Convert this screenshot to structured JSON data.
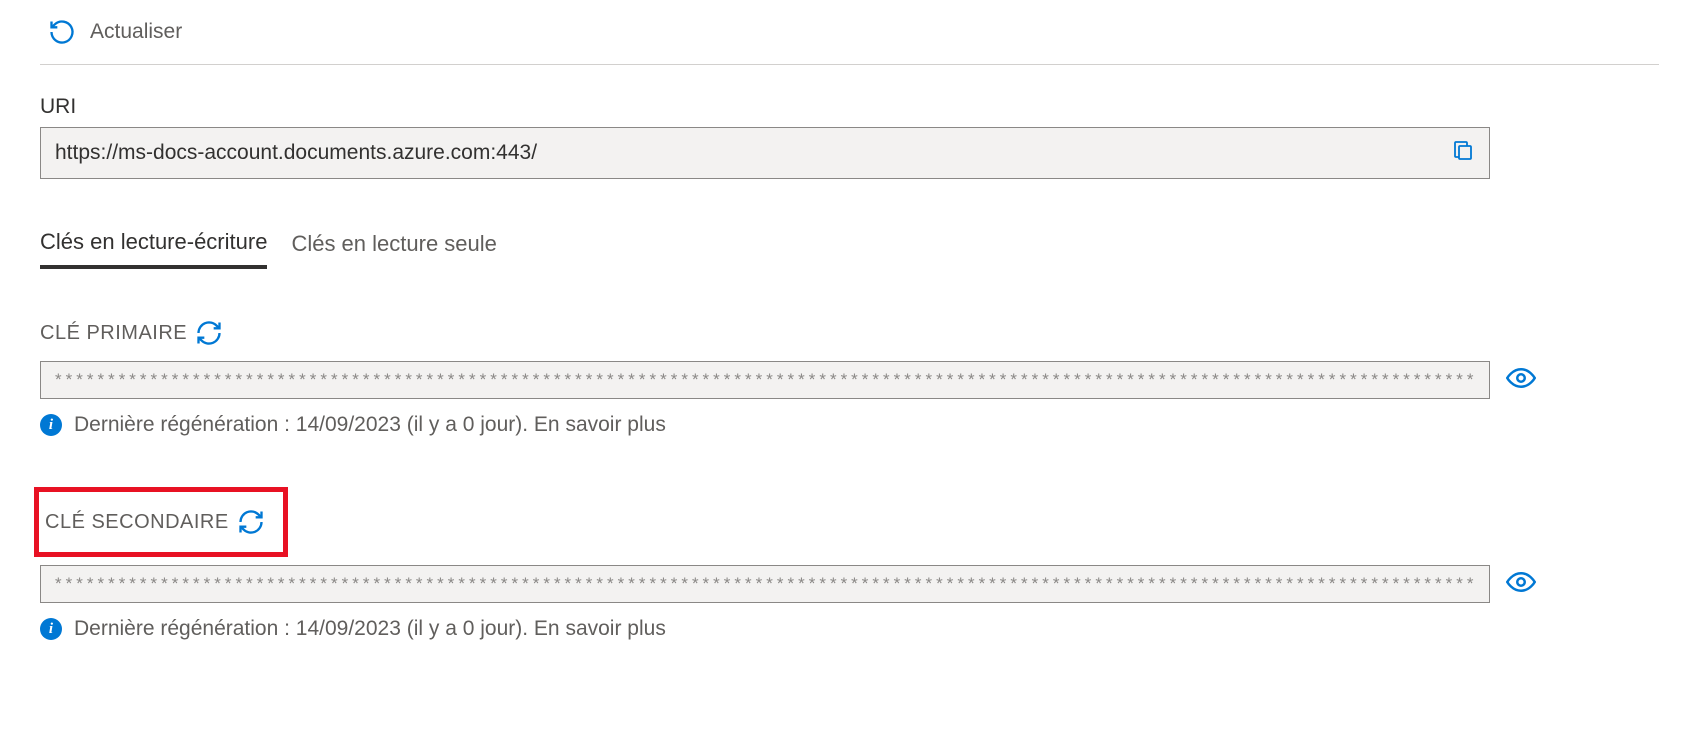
{
  "toolbar": {
    "refresh_label": "Actualiser"
  },
  "uri": {
    "label": "URI",
    "value": "https://ms-docs-account.documents.azure.com:443/"
  },
  "tabs": {
    "read_write": "Clés en lecture-écriture",
    "read_only": "Clés en lecture seule"
  },
  "keys": {
    "primary": {
      "label": "CLÉ PRIMAIRE",
      "value": "**************************************************************************************************************************************************************",
      "info": "Dernière régénération : 14/09/2023 (il y a 0 jour). En savoir plus"
    },
    "secondary": {
      "label": "CLÉ SECONDAIRE",
      "value": "**************************************************************************************************************************************************************",
      "info": "Dernière régénération : 14/09/2023 (il y a 0 jour). En savoir plus"
    }
  }
}
